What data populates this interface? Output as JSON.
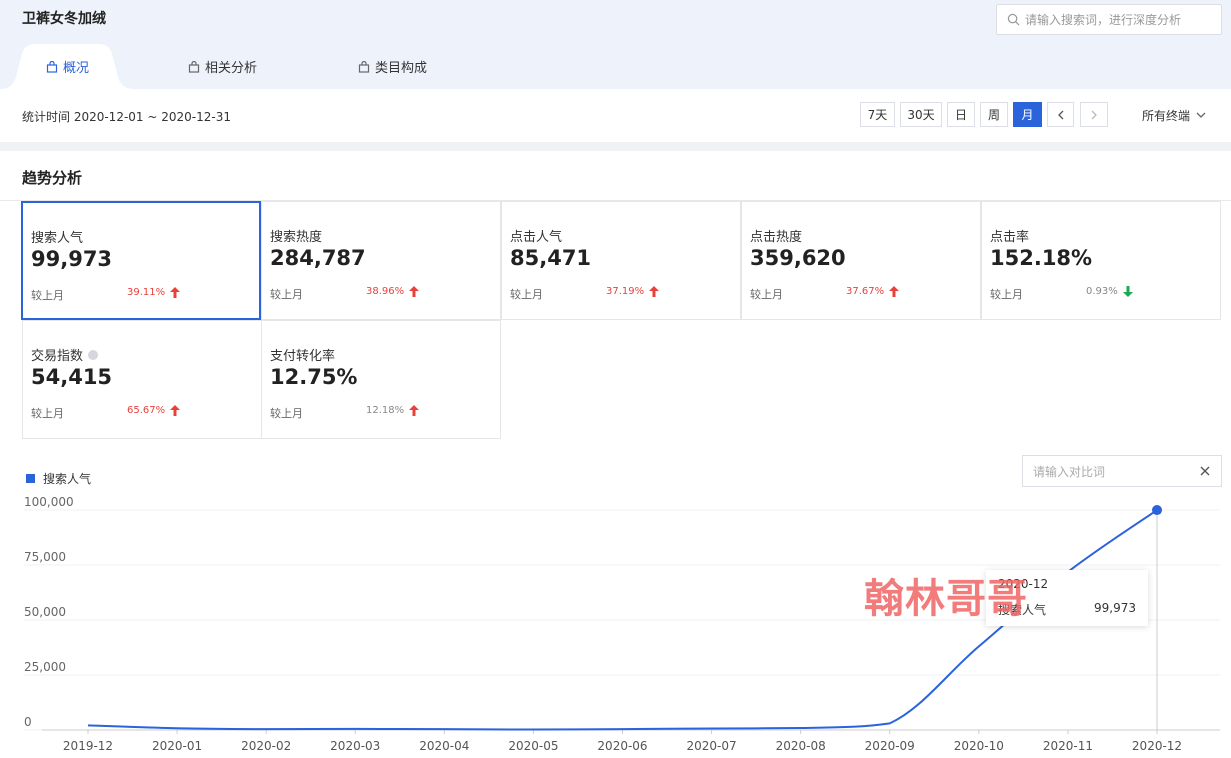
{
  "header": {
    "title": "卫裤女冬加绒",
    "search_placeholder": "请输入搜索词，进行深度分析"
  },
  "tabs": [
    {
      "label": "概况",
      "active": true
    },
    {
      "label": "相关分析",
      "active": false
    },
    {
      "label": "类目构成",
      "active": false
    }
  ],
  "toolbar": {
    "stat_time": "统计时间 2020-12-01 ~ 2020-12-31",
    "range_buttons": [
      {
        "label": "7天",
        "active": false
      },
      {
        "label": "30天",
        "active": false
      },
      {
        "label": "日",
        "active": false
      },
      {
        "label": "周",
        "active": false
      },
      {
        "label": "月",
        "active": true
      }
    ],
    "terminal": "所有终端"
  },
  "section": {
    "title": "趋势分析"
  },
  "metrics": [
    {
      "label": "搜索人气",
      "value": "99,973",
      "compare_label": "较上月",
      "change": "39.11%",
      "direction": "up",
      "selected": true
    },
    {
      "label": "搜索热度",
      "value": "284,787",
      "compare_label": "较上月",
      "change": "38.96%",
      "direction": "up",
      "selected": false
    },
    {
      "label": "点击人气",
      "value": "85,471",
      "compare_label": "较上月",
      "change": "37.19%",
      "direction": "up",
      "selected": false
    },
    {
      "label": "点击热度",
      "value": "359,620",
      "compare_label": "较上月",
      "change": "37.67%",
      "direction": "up",
      "selected": false
    },
    {
      "label": "点击率",
      "value": "152.18%",
      "compare_label": "较上月",
      "change": "0.93%",
      "direction": "down",
      "selected": false
    },
    {
      "label": "交易指数",
      "value": "54,415",
      "compare_label": "较上月",
      "change": "65.67%",
      "direction": "up",
      "selected": false
    },
    {
      "label": "支付转化率",
      "value": "12.75%",
      "compare_label": "较上月",
      "change": "12.18%",
      "direction": "up",
      "selected": false
    }
  ],
  "colors": {
    "accent": "#2b63db",
    "up": "#e8413b",
    "down": "#1aaa55"
  },
  "compare": {
    "placeholder": "请输入对比词"
  },
  "tooltip": {
    "title": "2020-12",
    "series_name": "搜索人气",
    "value": "99,973"
  },
  "watermark": "翰林哥哥",
  "chart_data": {
    "type": "line",
    "x": [
      "2019-12",
      "2020-01",
      "2020-02",
      "2020-03",
      "2020-04",
      "2020-05",
      "2020-06",
      "2020-07",
      "2020-08",
      "2020-09",
      "2020-10",
      "2020-11",
      "2020-12"
    ],
    "series": [
      {
        "name": "搜索人气",
        "values": [
          2100,
          800,
          400,
          500,
          400,
          200,
          400,
          700,
          900,
          3000,
          38000,
          71873,
          99973
        ]
      }
    ],
    "y_ticks": [
      "100,000",
      "75,000",
      "50,000",
      "25,000",
      "0"
    ],
    "ylim": [
      0,
      100000
    ],
    "grid": true,
    "legend": "top-left"
  }
}
